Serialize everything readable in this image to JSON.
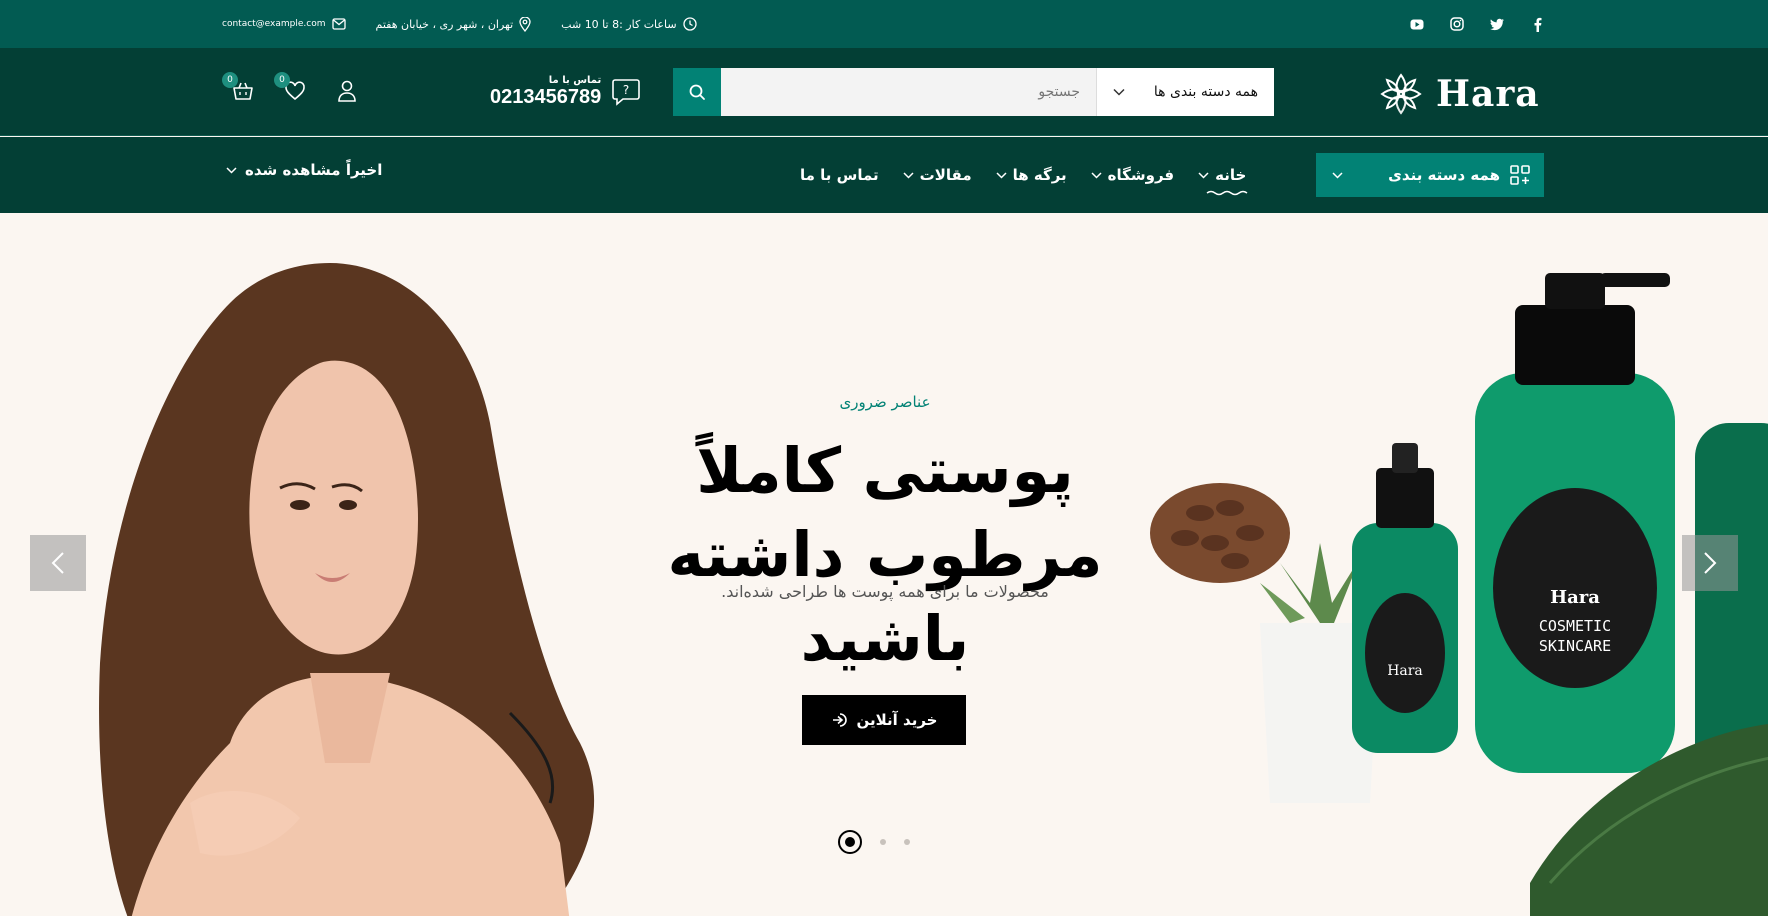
{
  "topbar": {
    "email": "contact@example.com",
    "address": "تهران ، شهر ری ، خیابان هفتم",
    "hours": "ساعات کار :8 تا 10 شب",
    "social": [
      "youtube-icon",
      "instagram-icon",
      "twitter-icon",
      "facebook-icon"
    ]
  },
  "header": {
    "cart_count": "0",
    "wishlist_count": "0",
    "contact_label": "تماس با ما",
    "phone": "0213456789",
    "search_placeholder": "جستجو",
    "category_select": "همه دسته بندی ها",
    "logo_text": "Hara"
  },
  "nav": {
    "all_categories": "همه دسته بندی",
    "items": [
      {
        "label": "خانه",
        "active": true
      },
      {
        "label": "فروشگاه"
      },
      {
        "label": "برگه ها"
      },
      {
        "label": "مقالات"
      },
      {
        "label": "تماس با ما"
      }
    ],
    "recent": "اخیراً مشاهده شده"
  },
  "hero": {
    "eyebrow": "عناصر ضروری",
    "title": "پوستی کاملاً مرطوب داشته باشید",
    "subtitle": "محصولات ما برای همه پوست ها طراحی شده‌اند.",
    "button": "خرید آنلاین",
    "product_brand": "Hara",
    "product_line1": "COSMETIC",
    "product_line2": "SKINCARE",
    "slides": 3,
    "active_slide": 1
  },
  "colors": {
    "topbar": "#025b52",
    "header": "#033f35",
    "accent": "#028275",
    "hero_bg": "#fbf6f1"
  }
}
